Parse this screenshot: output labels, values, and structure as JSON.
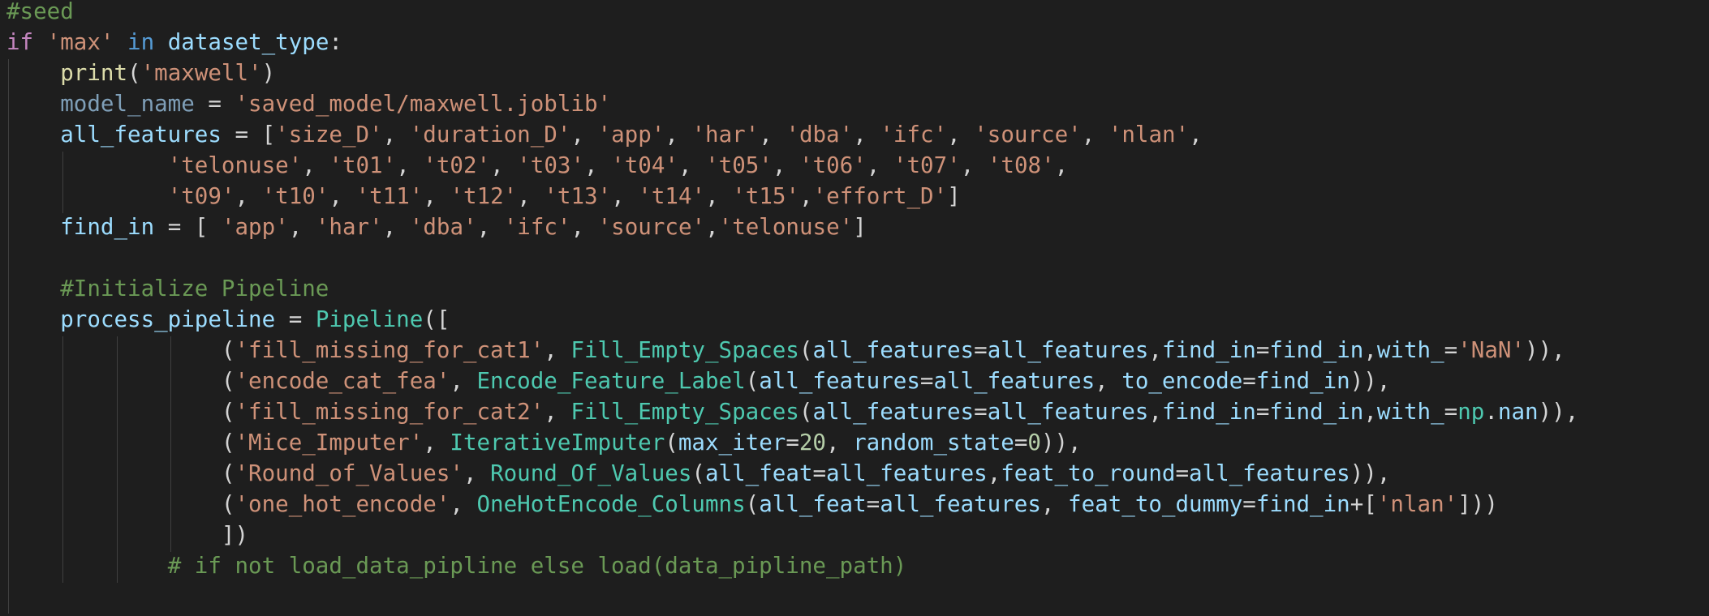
{
  "editor": {
    "language": "python",
    "lines": [
      [
        {
          "t": "#seed",
          "c": "comment"
        }
      ],
      [
        {
          "t": "if",
          "c": "keyword"
        },
        {
          "t": " ",
          "c": "plain"
        },
        {
          "t": "'max'",
          "c": "string"
        },
        {
          "t": " ",
          "c": "plain"
        },
        {
          "t": "in",
          "c": "inop"
        },
        {
          "t": " ",
          "c": "plain"
        },
        {
          "t": "dataset_type",
          "c": "var"
        },
        {
          "t": ":",
          "c": "plain"
        }
      ],
      [
        {
          "t": "    ",
          "c": "plain"
        },
        {
          "t": "print",
          "c": "func"
        },
        {
          "t": "(",
          "c": "plain"
        },
        {
          "t": "'maxwell'",
          "c": "string"
        },
        {
          "t": ")",
          "c": "plain"
        }
      ],
      [
        {
          "t": "    ",
          "c": "plain"
        },
        {
          "t": "model_name",
          "c": "dim"
        },
        {
          "t": " = ",
          "c": "plain"
        },
        {
          "t": "'saved_model/maxwell.joblib'",
          "c": "string"
        }
      ],
      [
        {
          "t": "    ",
          "c": "plain"
        },
        {
          "t": "all_features",
          "c": "var"
        },
        {
          "t": " = [",
          "c": "plain"
        },
        {
          "t": "'size_D'",
          "c": "string"
        },
        {
          "t": ", ",
          "c": "plain"
        },
        {
          "t": "'duration_D'",
          "c": "string"
        },
        {
          "t": ", ",
          "c": "plain"
        },
        {
          "t": "'app'",
          "c": "string"
        },
        {
          "t": ", ",
          "c": "plain"
        },
        {
          "t": "'har'",
          "c": "string"
        },
        {
          "t": ", ",
          "c": "plain"
        },
        {
          "t": "'dba'",
          "c": "string"
        },
        {
          "t": ", ",
          "c": "plain"
        },
        {
          "t": "'ifc'",
          "c": "string"
        },
        {
          "t": ", ",
          "c": "plain"
        },
        {
          "t": "'source'",
          "c": "string"
        },
        {
          "t": ", ",
          "c": "plain"
        },
        {
          "t": "'nlan'",
          "c": "string"
        },
        {
          "t": ",",
          "c": "plain"
        }
      ],
      [
        {
          "t": "            ",
          "c": "plain"
        },
        {
          "t": "'telonuse'",
          "c": "string"
        },
        {
          "t": ", ",
          "c": "plain"
        },
        {
          "t": "'t01'",
          "c": "string"
        },
        {
          "t": ", ",
          "c": "plain"
        },
        {
          "t": "'t02'",
          "c": "string"
        },
        {
          "t": ", ",
          "c": "plain"
        },
        {
          "t": "'t03'",
          "c": "string"
        },
        {
          "t": ", ",
          "c": "plain"
        },
        {
          "t": "'t04'",
          "c": "string"
        },
        {
          "t": ", ",
          "c": "plain"
        },
        {
          "t": "'t05'",
          "c": "string"
        },
        {
          "t": ", ",
          "c": "plain"
        },
        {
          "t": "'t06'",
          "c": "string"
        },
        {
          "t": ", ",
          "c": "plain"
        },
        {
          "t": "'t07'",
          "c": "string"
        },
        {
          "t": ", ",
          "c": "plain"
        },
        {
          "t": "'t08'",
          "c": "string"
        },
        {
          "t": ",",
          "c": "plain"
        }
      ],
      [
        {
          "t": "            ",
          "c": "plain"
        },
        {
          "t": "'t09'",
          "c": "string"
        },
        {
          "t": ", ",
          "c": "plain"
        },
        {
          "t": "'t10'",
          "c": "string"
        },
        {
          "t": ", ",
          "c": "plain"
        },
        {
          "t": "'t11'",
          "c": "string"
        },
        {
          "t": ", ",
          "c": "plain"
        },
        {
          "t": "'t12'",
          "c": "string"
        },
        {
          "t": ", ",
          "c": "plain"
        },
        {
          "t": "'t13'",
          "c": "string"
        },
        {
          "t": ", ",
          "c": "plain"
        },
        {
          "t": "'t14'",
          "c": "string"
        },
        {
          "t": ", ",
          "c": "plain"
        },
        {
          "t": "'t15'",
          "c": "string"
        },
        {
          "t": ",",
          "c": "plain"
        },
        {
          "t": "'effort_D'",
          "c": "string"
        },
        {
          "t": "]",
          "c": "plain"
        }
      ],
      [
        {
          "t": "    ",
          "c": "plain"
        },
        {
          "t": "find_in",
          "c": "var"
        },
        {
          "t": " = [ ",
          "c": "plain"
        },
        {
          "t": "'app'",
          "c": "string"
        },
        {
          "t": ", ",
          "c": "plain"
        },
        {
          "t": "'har'",
          "c": "string"
        },
        {
          "t": ", ",
          "c": "plain"
        },
        {
          "t": "'dba'",
          "c": "string"
        },
        {
          "t": ", ",
          "c": "plain"
        },
        {
          "t": "'ifc'",
          "c": "string"
        },
        {
          "t": ", ",
          "c": "plain"
        },
        {
          "t": "'source'",
          "c": "string"
        },
        {
          "t": ",",
          "c": "plain"
        },
        {
          "t": "'telonuse'",
          "c": "string"
        },
        {
          "t": "]",
          "c": "plain"
        }
      ],
      [],
      [
        {
          "t": "    ",
          "c": "plain"
        },
        {
          "t": "#Initialize Pipeline",
          "c": "comment"
        }
      ],
      [
        {
          "t": "    ",
          "c": "plain"
        },
        {
          "t": "process_pipeline",
          "c": "var"
        },
        {
          "t": " = ",
          "c": "plain"
        },
        {
          "t": "Pipeline",
          "c": "class"
        },
        {
          "t": "([",
          "c": "plain"
        }
      ],
      [
        {
          "t": "                ",
          "c": "plain"
        },
        {
          "t": "(",
          "c": "plain"
        },
        {
          "t": "'fill_missing_for_cat1'",
          "c": "string"
        },
        {
          "t": ", ",
          "c": "plain"
        },
        {
          "t": "Fill_Empty_Spaces",
          "c": "class"
        },
        {
          "t": "(",
          "c": "plain"
        },
        {
          "t": "all_features",
          "c": "var"
        },
        {
          "t": "=",
          "c": "plain"
        },
        {
          "t": "all_features",
          "c": "var"
        },
        {
          "t": ",",
          "c": "plain"
        },
        {
          "t": "find_in",
          "c": "var"
        },
        {
          "t": "=",
          "c": "plain"
        },
        {
          "t": "find_in",
          "c": "var"
        },
        {
          "t": ",",
          "c": "plain"
        },
        {
          "t": "with_",
          "c": "var"
        },
        {
          "t": "=",
          "c": "plain"
        },
        {
          "t": "'NaN'",
          "c": "string"
        },
        {
          "t": ")),",
          "c": "plain"
        }
      ],
      [
        {
          "t": "                ",
          "c": "plain"
        },
        {
          "t": "(",
          "c": "plain"
        },
        {
          "t": "'encode_cat_fea'",
          "c": "string"
        },
        {
          "t": ", ",
          "c": "plain"
        },
        {
          "t": "Encode_Feature_Label",
          "c": "class"
        },
        {
          "t": "(",
          "c": "plain"
        },
        {
          "t": "all_features",
          "c": "var"
        },
        {
          "t": "=",
          "c": "plain"
        },
        {
          "t": "all_features",
          "c": "var"
        },
        {
          "t": ", ",
          "c": "plain"
        },
        {
          "t": "to_encode",
          "c": "var"
        },
        {
          "t": "=",
          "c": "plain"
        },
        {
          "t": "find_in",
          "c": "var"
        },
        {
          "t": ")),",
          "c": "plain"
        }
      ],
      [
        {
          "t": "                ",
          "c": "plain"
        },
        {
          "t": "(",
          "c": "plain"
        },
        {
          "t": "'fill_missing_for_cat2'",
          "c": "string"
        },
        {
          "t": ", ",
          "c": "plain"
        },
        {
          "t": "Fill_Empty_Spaces",
          "c": "class"
        },
        {
          "t": "(",
          "c": "plain"
        },
        {
          "t": "all_features",
          "c": "var"
        },
        {
          "t": "=",
          "c": "plain"
        },
        {
          "t": "all_features",
          "c": "var"
        },
        {
          "t": ",",
          "c": "plain"
        },
        {
          "t": "find_in",
          "c": "var"
        },
        {
          "t": "=",
          "c": "plain"
        },
        {
          "t": "find_in",
          "c": "var"
        },
        {
          "t": ",",
          "c": "plain"
        },
        {
          "t": "with_",
          "c": "var"
        },
        {
          "t": "=",
          "c": "plain"
        },
        {
          "t": "np",
          "c": "class"
        },
        {
          "t": ".",
          "c": "plain"
        },
        {
          "t": "nan",
          "c": "var"
        },
        {
          "t": ")),",
          "c": "plain"
        }
      ],
      [
        {
          "t": "                ",
          "c": "plain"
        },
        {
          "t": "(",
          "c": "plain"
        },
        {
          "t": "'Mice_Imputer'",
          "c": "string"
        },
        {
          "t": ", ",
          "c": "plain"
        },
        {
          "t": "IterativeImputer",
          "c": "class"
        },
        {
          "t": "(",
          "c": "plain"
        },
        {
          "t": "max_iter",
          "c": "var"
        },
        {
          "t": "=",
          "c": "plain"
        },
        {
          "t": "20",
          "c": "number"
        },
        {
          "t": ", ",
          "c": "plain"
        },
        {
          "t": "random_state",
          "c": "var"
        },
        {
          "t": "=",
          "c": "plain"
        },
        {
          "t": "0",
          "c": "number"
        },
        {
          "t": ")),",
          "c": "plain"
        }
      ],
      [
        {
          "t": "                ",
          "c": "plain"
        },
        {
          "t": "(",
          "c": "plain"
        },
        {
          "t": "'Round_of_Values'",
          "c": "string"
        },
        {
          "t": ", ",
          "c": "plain"
        },
        {
          "t": "Round_Of_Values",
          "c": "class"
        },
        {
          "t": "(",
          "c": "plain"
        },
        {
          "t": "all_feat",
          "c": "var"
        },
        {
          "t": "=",
          "c": "plain"
        },
        {
          "t": "all_features",
          "c": "var"
        },
        {
          "t": ",",
          "c": "plain"
        },
        {
          "t": "feat_to_round",
          "c": "var"
        },
        {
          "t": "=",
          "c": "plain"
        },
        {
          "t": "all_features",
          "c": "var"
        },
        {
          "t": ")),",
          "c": "plain"
        }
      ],
      [
        {
          "t": "                ",
          "c": "plain"
        },
        {
          "t": "(",
          "c": "plain"
        },
        {
          "t": "'one_hot_encode'",
          "c": "string"
        },
        {
          "t": ", ",
          "c": "plain"
        },
        {
          "t": "OneHotEncode_Columns",
          "c": "class"
        },
        {
          "t": "(",
          "c": "plain"
        },
        {
          "t": "all_feat",
          "c": "var"
        },
        {
          "t": "=",
          "c": "plain"
        },
        {
          "t": "all_features",
          "c": "var"
        },
        {
          "t": ", ",
          "c": "plain"
        },
        {
          "t": "feat_to_dummy",
          "c": "var"
        },
        {
          "t": "=",
          "c": "plain"
        },
        {
          "t": "find_in",
          "c": "var"
        },
        {
          "t": "+[",
          "c": "plain"
        },
        {
          "t": "'nlan'",
          "c": "string"
        },
        {
          "t": "]))",
          "c": "plain"
        }
      ],
      [
        {
          "t": "                ",
          "c": "plain"
        },
        {
          "t": "])",
          "c": "plain"
        }
      ],
      [
        {
          "t": "            ",
          "c": "plain"
        },
        {
          "t": "# if not load_data_pipline else load(data_pipline_path)",
          "c": "comment"
        }
      ]
    ]
  }
}
